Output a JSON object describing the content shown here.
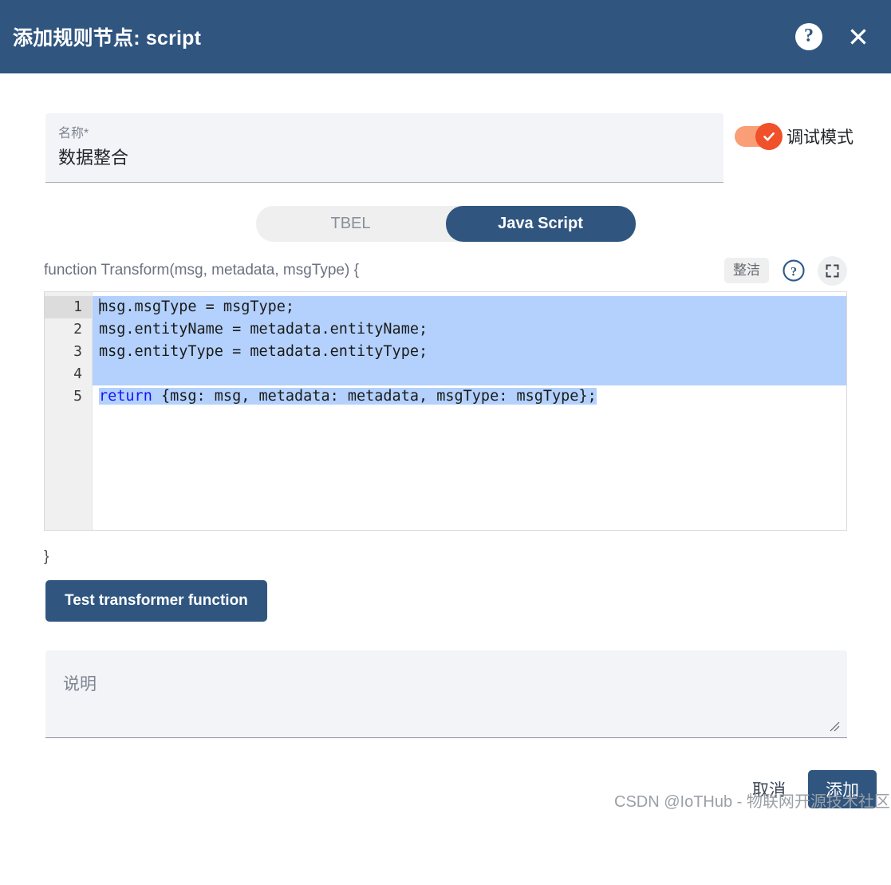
{
  "header": {
    "title": "添加规则节点: script",
    "help_icon": "question-mark-circle-icon",
    "close_icon": "close-icon",
    "background_color": "#305680"
  },
  "name_field": {
    "label": "名称*",
    "value": "数据整合"
  },
  "debug_toggle": {
    "label": "调试模式",
    "state": "on",
    "on_color": "#f0502a",
    "track_color": "#f99e76"
  },
  "language_tabs": {
    "options": [
      "TBEL",
      "Java Script"
    ],
    "selected": "Java Script",
    "active_color": "#305680"
  },
  "code": {
    "signature": "function Transform(msg, metadata, msgType) {",
    "closing_brace": "}",
    "tidy_label": "整洁",
    "help_icon": "question-mark-circle-outline-icon",
    "fullscreen_icon": "fullscreen-icon",
    "selection_color": "#b3d1fc",
    "lines": [
      {
        "number": "1",
        "text": "msg.msgType = msgType;"
      },
      {
        "number": "2",
        "text": "msg.entityName = metadata.entityName;"
      },
      {
        "number": "3",
        "text": "msg.entityType = metadata.entityType;"
      },
      {
        "number": "4",
        "text": ""
      },
      {
        "number": "5",
        "keyword": "return",
        "text": " {msg: msg, metadata: metadata, msgType: msgType};"
      }
    ]
  },
  "test_button": {
    "label": "Test transformer function"
  },
  "description_field": {
    "placeholder": "说明",
    "value": "",
    "resize_icon": "resize-grip-icon"
  },
  "footer": {
    "cancel_label": "取消",
    "submit_label": "添加"
  },
  "watermark": {
    "text": "CSDN @IoTHub - 物联网开源技术社区"
  }
}
